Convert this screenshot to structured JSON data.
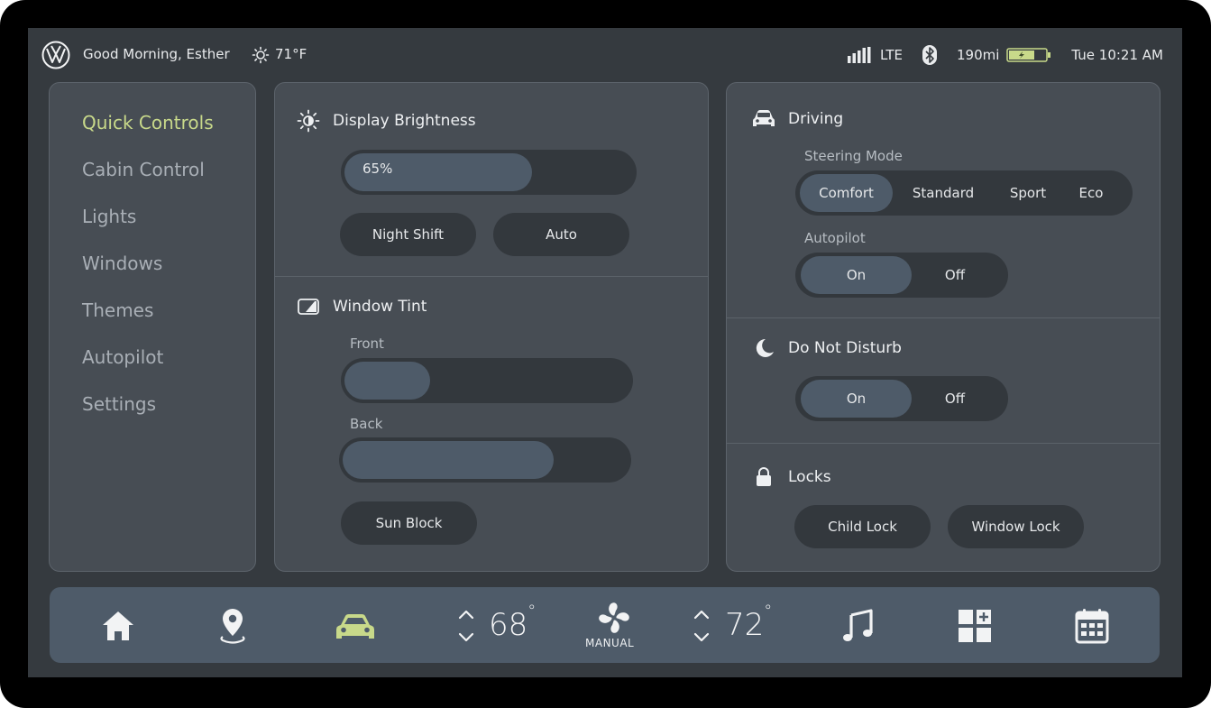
{
  "status_bar": {
    "greeting": "Good Morning, Esther",
    "outside_temp": "71°F",
    "network": "LTE",
    "range": "190mi",
    "datetime": "Tue 10:21 AM",
    "battery_level": 0.65
  },
  "sidebar": {
    "items": [
      {
        "label": "Quick Controls",
        "active": true
      },
      {
        "label": "Cabin Control",
        "active": false
      },
      {
        "label": "Lights",
        "active": false
      },
      {
        "label": "Windows",
        "active": false
      },
      {
        "label": "Themes",
        "active": false
      },
      {
        "label": "Autopilot",
        "active": false
      },
      {
        "label": "Settings",
        "active": false
      }
    ]
  },
  "display_brightness": {
    "title": "Display Brightness",
    "value_label": "65%",
    "value": 0.65,
    "night_shift_label": "Night Shift",
    "auto_label": "Auto"
  },
  "window_tint": {
    "title": "Window Tint",
    "front_label": "Front",
    "front_value": 0.3,
    "back_label": "Back",
    "back_value": 0.74,
    "sun_block_label": "Sun Block"
  },
  "driving": {
    "title": "Driving",
    "steering_label": "Steering Mode",
    "steering_options": [
      "Comfort",
      "Standard",
      "Sport",
      "Eco"
    ],
    "steering_selected": "Comfort",
    "autopilot_label": "Autopilot",
    "autopilot_on": "On",
    "autopilot_off": "Off",
    "autopilot_selected": "On"
  },
  "do_not_disturb": {
    "title": "Do Not Disturb",
    "on": "On",
    "off": "Off",
    "selected": "On"
  },
  "locks": {
    "title": "Locks",
    "child_lock": "Child Lock",
    "window_lock": "Window Lock"
  },
  "dock": {
    "driver_temp": "68",
    "passenger_temp": "72",
    "degree_symbol": "°",
    "fan_mode": "MANUAL",
    "active_icon": "car-icon"
  },
  "colors": {
    "accent": "#c8d98a",
    "panel": "#474d54",
    "track": "#33383d",
    "selected": "#4e5b69",
    "background": "#353a3f"
  }
}
